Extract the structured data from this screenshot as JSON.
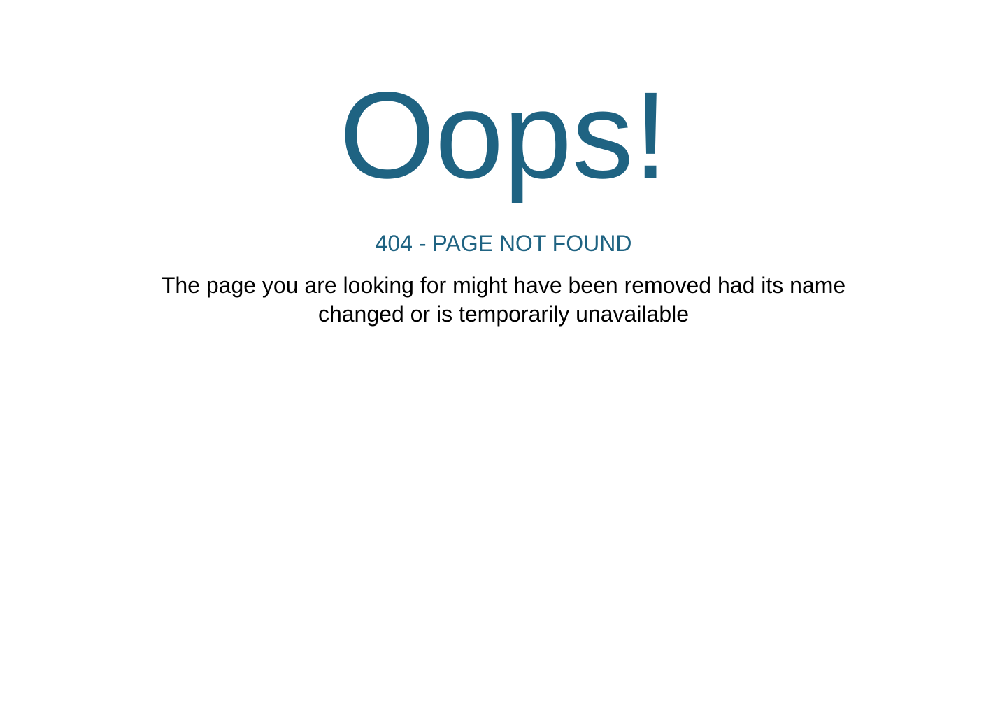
{
  "error": {
    "headline": "Oops!",
    "subheadline": "404 - PAGE NOT FOUND",
    "message": "The page you are looking for might have been removed had its name changed or is temporarily unavailable"
  },
  "colors": {
    "accent": "#1f6382",
    "body_text": "#000000",
    "background": "#ffffff"
  }
}
